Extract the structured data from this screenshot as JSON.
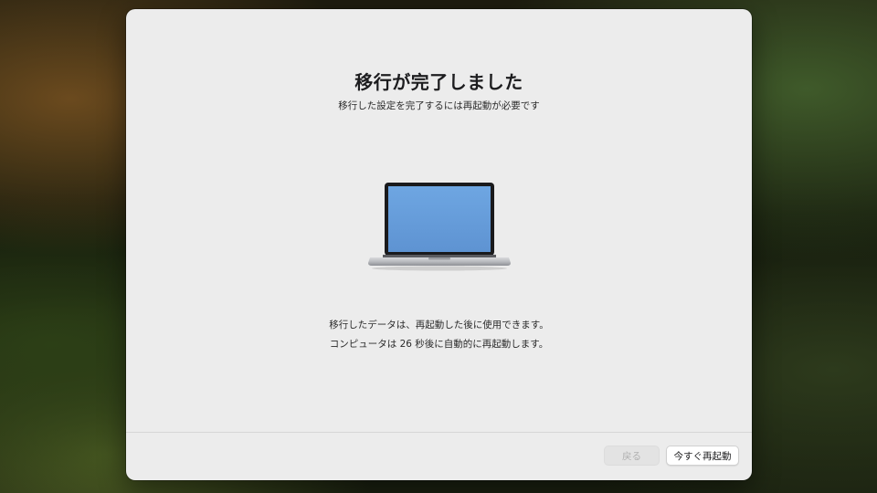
{
  "dialog": {
    "title": "移行が完了しました",
    "subtitle": "移行した設定を完了するには再起動が必要です",
    "message_line1": "移行したデータは、再起動した後に使用できます。",
    "message_line2": "コンピュータは 26 秒後に自動的に再起動します。",
    "countdown_seconds": 26,
    "illustration_icon": "laptop-icon"
  },
  "footer": {
    "back_label": "戻る",
    "back_enabled": false,
    "restart_label": "今すぐ再起動"
  },
  "colors": {
    "window_bg": "#ececec",
    "screen_blue": "#6aa0dc",
    "disabled_text": "#b0b0b0"
  }
}
